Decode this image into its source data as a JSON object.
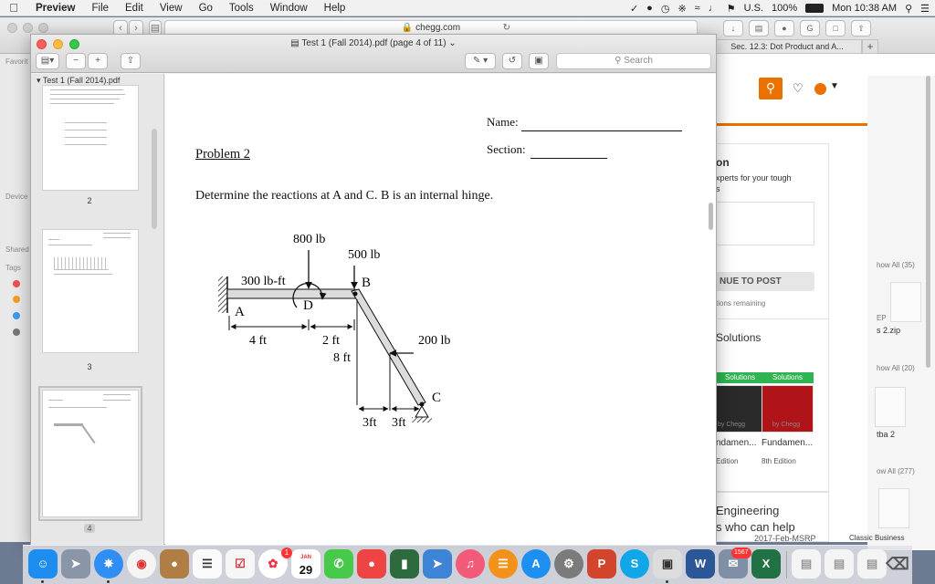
{
  "menubar": {
    "apple": "",
    "app_name": "Preview",
    "items": [
      "File",
      "Edit",
      "View",
      "Go",
      "Tools",
      "Window",
      "Help"
    ],
    "input_source": "U.S.",
    "battery": "100%",
    "clock": "Mon 10:38 AM"
  },
  "safari": {
    "url": "chegg.com",
    "right_tab": "Sec. 12.3: Dot Product and A...",
    "plus": "+"
  },
  "chegg": {
    "snippet_on": "on",
    "snippet_experts": "xperts for your tough",
    "snippet_s": "s",
    "continue_btn": "NUE TO POST",
    "remaining": "tions remaining",
    "solutions_heading": "Solutions",
    "tag1": "Solutions",
    "tag2": "Solutions",
    "chegg1": "by Chegg",
    "chegg2": "by Chegg",
    "book1_title": "ndamen...",
    "book2_title": "Fundamen...",
    "book1_edition": "Edition",
    "book2_edition": "8th Edition",
    "engineering": "Engineering",
    "who_can_help": "s who can help",
    "bottom_text": "2017-Feb-MSRP",
    "bottom_right": "Classic Business"
  },
  "side_strip": {
    "show_all_1": "how All (35)",
    "zip": "s 2.zip",
    "show_all_2": "how All (20)",
    "file2": "tba 2",
    "show_all_3": "ow All (277)",
    "ep": "EP"
  },
  "finder_sidebar": {
    "favorites": "Favorit",
    "devices": "Device",
    "shared": "Shared",
    "tags": "Tags"
  },
  "preview": {
    "window_title": "Test 1 (Fall 2014).pdf (page 4 of 11)",
    "search_placeholder": "Search",
    "sidebar_title": "Test 1 (Fall 2014).pdf",
    "thumb_numbers": [
      "2",
      "3",
      "4"
    ]
  },
  "document": {
    "name_label": "Name:",
    "section_label": "Section:",
    "problem_title": "Problem 2",
    "question": "Determine the reactions at A and C.  B is an internal hinge."
  },
  "diagram": {
    "load_800": "800 lb",
    "load_500": "500 lb",
    "moment_300": "300 lb-ft",
    "label_B": "B",
    "label_A": "A",
    "label_D": "D",
    "label_C": "C",
    "dim_4ft": "4 ft",
    "dim_2ft": "2 ft",
    "dim_8ft": "8 ft",
    "load_200": "200 lb",
    "dim_3ft_a": "3ft",
    "dim_3ft_b": "3ft"
  },
  "dock": {
    "calendar_month": "JAN",
    "calendar_day": "29",
    "badge_mail": "1",
    "badge_other": "1567"
  },
  "colors": {
    "chegg_orange": "#eb7100",
    "chegg_green": "#2fb451",
    "traffic_red": "#fc605b",
    "traffic_yellow": "#fdbc40",
    "traffic_green": "#34c84a"
  }
}
